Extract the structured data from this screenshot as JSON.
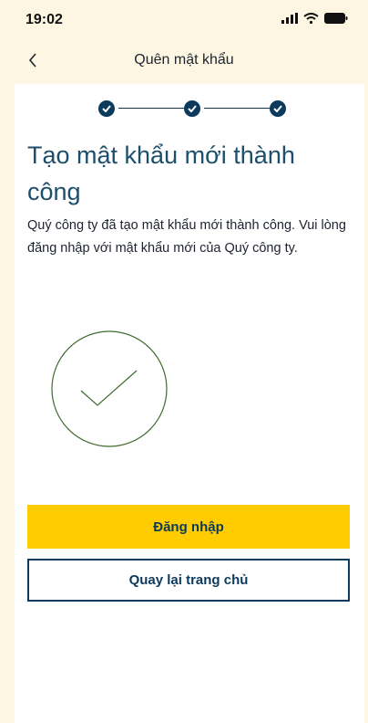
{
  "status_bar": {
    "time": "19:02",
    "icons": [
      "signal-icon",
      "wifi-icon",
      "battery-icon"
    ]
  },
  "header": {
    "back_icon": "chevron-left-icon",
    "title": "Quên mật khẩu"
  },
  "stepper": {
    "steps_completed": 3,
    "steps_total": 3
  },
  "main": {
    "heading": "Tạo mật khẩu mới thành công",
    "description": "Quý công ty đã tạo mật khẩu mới thành công. Vui lòng đăng nhập với mật khẩu mới của Quý công ty.",
    "graphic_icon": "checkmark-circle-icon"
  },
  "actions": {
    "login_label": "Đăng nhập",
    "home_label": "Quay lại trang chủ"
  },
  "colors": {
    "background": "#fdf6e3",
    "primary_navy": "#0c3a5c",
    "accent_yellow": "#ffcc00",
    "success_green": "#3e6b2e",
    "heading_blue": "#1c4f6b"
  }
}
